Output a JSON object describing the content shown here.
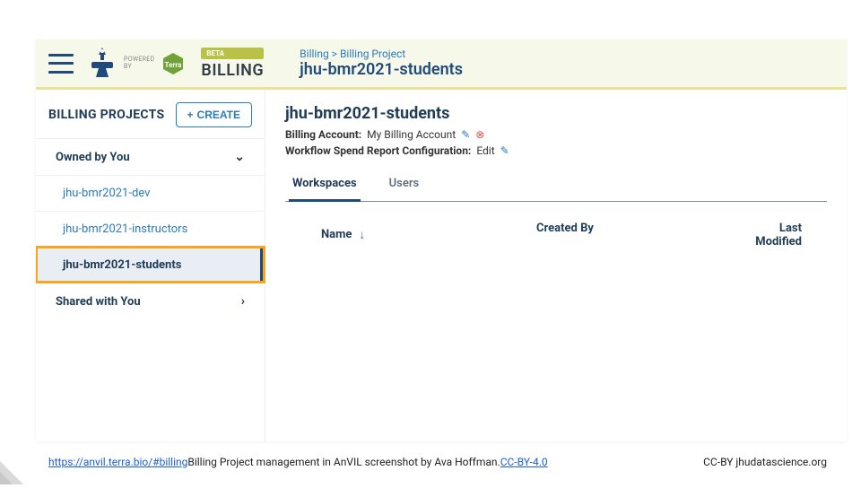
{
  "header": {
    "powered_by": "POWERED\nBY",
    "beta": "BETA",
    "billing_label": "BILLING",
    "breadcrumb_parent": "Billing",
    "breadcrumb_child": "Billing Project",
    "subtitle": "jhu-bmr2021-students"
  },
  "sidebar": {
    "title": "BILLING PROJECTS",
    "create_label": "CREATE",
    "sections": {
      "owned": "Owned by You",
      "shared": "Shared with You"
    },
    "projects": [
      "jhu-bmr2021-dev",
      "jhu-bmr2021-instructors",
      "jhu-bmr2021-students"
    ]
  },
  "main": {
    "project_title": "jhu-bmr2021-students",
    "billing_account_label": "Billing Account:",
    "billing_account_value": "My Billing Account",
    "workflow_label": "Workflow Spend Report Configuration:",
    "workflow_value": "Edit",
    "tabs": {
      "workspaces": "Workspaces",
      "users": "Users"
    },
    "columns": {
      "name": "Name",
      "created": "Created By",
      "modified": "Last Modified"
    }
  },
  "footer": {
    "url": "https://anvil.terra.bio/#billing",
    "caption": " Billing Project management in AnVIL screenshot by Ava Hoffman. ",
    "license": "CC-BY-4.0",
    "right": "CC-BY  jhudatascience.org"
  }
}
